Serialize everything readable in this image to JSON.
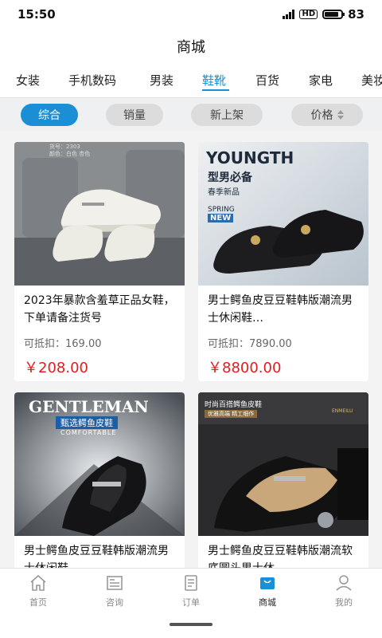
{
  "status": {
    "time": "15:50",
    "battery": "83"
  },
  "title": "商城",
  "categories": [
    "女装",
    "手机数码",
    "男装",
    "鞋靴",
    "百货",
    "家电",
    "美妆"
  ],
  "active_category": "鞋靴",
  "filters": [
    "综合",
    "销量",
    "新上架",
    "价格"
  ],
  "active_filter": "综合",
  "products": [
    {
      "name": "2023年暴款含羞草正品女鞋，下单请备注货号",
      "deduct_label": "可抵扣：",
      "deduct_value": "169.00",
      "price": "￥208.00",
      "image_text": [
        "货号：2303",
        "颜色：白色 杏色"
      ]
    },
    {
      "name": "男士鳄鱼皮豆豆鞋韩版潮流男士休闲鞋…",
      "deduct_label": "可抵扣：",
      "deduct_value": "7890.00",
      "price": "￥8800.00",
      "image_text": [
        "YOUNGTH",
        "型男必备",
        "春季新品",
        "SPRING",
        "NEW"
      ]
    },
    {
      "name": "男士鳄鱼皮豆豆鞋韩版潮流男士休闲鞋",
      "deduct_label": "",
      "deduct_value": "",
      "price": "",
      "image_text": [
        "GENTLEMAN",
        "甄选鳄鱼皮鞋",
        "COMFORTABLE"
      ]
    },
    {
      "name": "男士鳄鱼皮豆豆鞋韩版潮流软底圆头男士休…",
      "deduct_label": "",
      "deduct_value": "",
      "price": "",
      "image_text": [
        "时尚百搭鳄鱼皮鞋",
        "ENMEILU",
        "优雅高端 精工细作"
      ]
    }
  ],
  "nav": [
    {
      "label": "首页",
      "icon": "home-icon"
    },
    {
      "label": "咨询",
      "icon": "news-icon"
    },
    {
      "label": "订单",
      "icon": "order-icon"
    },
    {
      "label": "商城",
      "icon": "mall-icon"
    },
    {
      "label": "我的",
      "icon": "profile-icon"
    }
  ],
  "active_nav": "商城",
  "colors": {
    "accent": "#1b8fd6",
    "price": "#e61c1c"
  }
}
